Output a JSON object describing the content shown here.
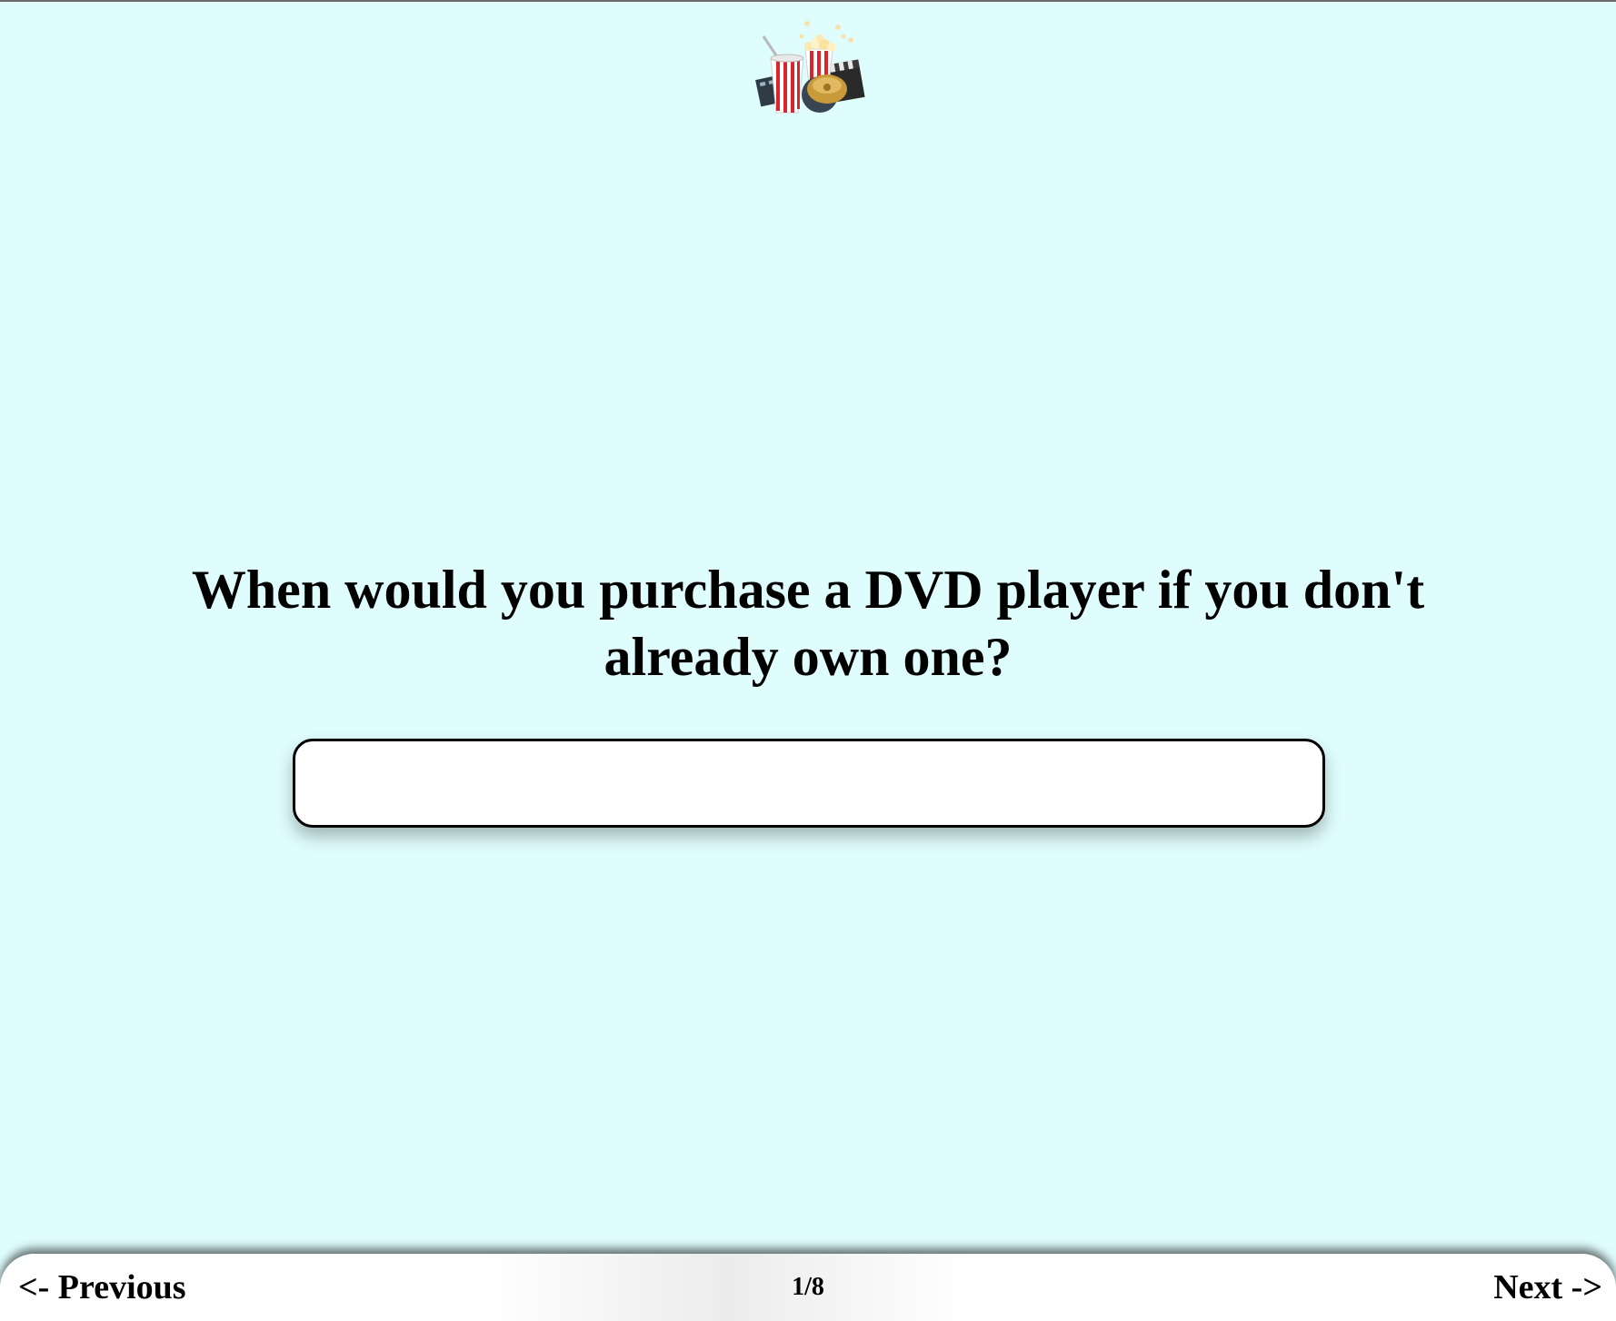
{
  "question": {
    "text": "When would you purchase a DVD player if you don't already own one?"
  },
  "answer": {
    "value": "",
    "placeholder": ""
  },
  "navigation": {
    "previous_label": "<- Previous",
    "page_indicator": "1/8",
    "next_label": "Next ->"
  },
  "logo": {
    "icon": "movie-snacks-icon"
  },
  "colors": {
    "background": "#e0fdfd",
    "nav_bar": "#ffffff",
    "input_border": "#000000"
  }
}
